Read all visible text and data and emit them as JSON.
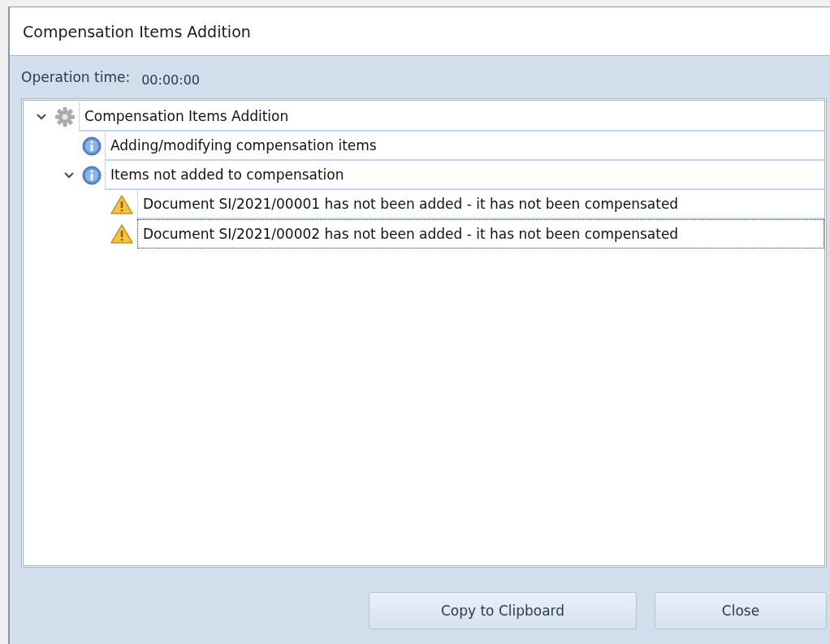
{
  "window": {
    "title": "Compensation Items Addition"
  },
  "operation_time": {
    "label": "Operation time:",
    "value": "00:00:00"
  },
  "tree": [
    {
      "kind": "gear",
      "label": "Compensation Items Addition",
      "expanded": true,
      "selected": false,
      "children": [
        {
          "kind": "info",
          "label": "Adding/modifying compensation items",
          "selected": false
        },
        {
          "kind": "info",
          "label": "Items not added to compensation",
          "expanded": true,
          "selected": false,
          "children": [
            {
              "kind": "warning",
              "label": "Document SI/2021/00001 has not been added - it has not been compensated",
              "selected": false
            },
            {
              "kind": "warning",
              "label": "Document SI/2021/00002 has not been added - it has not been compensated",
              "selected": true
            }
          ]
        }
      ]
    }
  ],
  "buttons": [
    "Copy to Clipboard",
    "Close"
  ]
}
